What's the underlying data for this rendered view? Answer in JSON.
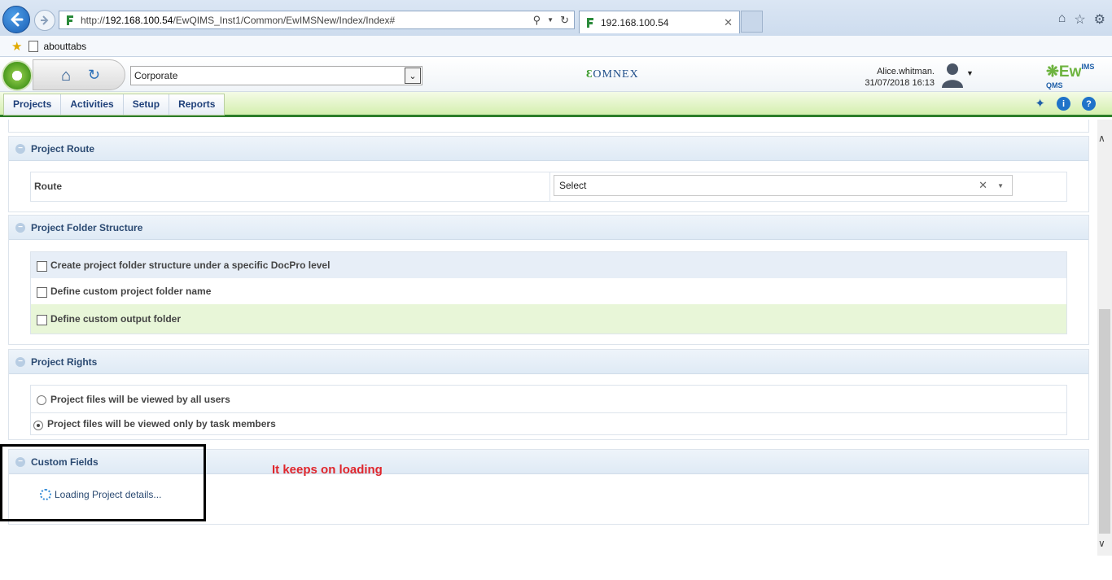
{
  "browser": {
    "url_prefix": "http://",
    "url_host": "192.168.100.54",
    "url_path": "/EwQIMS_Inst1/Common/EwIMSNew/Index/Index#",
    "tab_title": "192.168.100.54",
    "favorite": "abouttabs"
  },
  "header": {
    "site_select": "Corporate",
    "logo_text": "OMNEX",
    "user_name": "Alice.whitman.",
    "datetime": "31/07/2018 16:13",
    "brand": "Ew",
    "brand_sup": "IMS",
    "brand_sub": "QMS"
  },
  "menu": {
    "items": [
      "Projects",
      "Activities",
      "Setup",
      "Reports"
    ]
  },
  "sections": {
    "route": {
      "title": "Project Route",
      "label": "Route",
      "select_value": "Select"
    },
    "folder": {
      "title": "Project Folder Structure",
      "options": [
        "Create project folder structure under a specific DocPro level",
        "Define custom project folder name",
        "Define custom output folder"
      ]
    },
    "rights": {
      "title": "Project Rights",
      "options": [
        "Project files will be viewed by all users",
        "Project files will be viewed only by task members"
      ],
      "selected_index": 1
    },
    "custom": {
      "title": "Custom Fields",
      "loading": "Loading Project details..."
    }
  },
  "annotation": {
    "text": "It keeps on loading"
  },
  "colors": {
    "accent": "#2c7d2a",
    "menu_text": "#20417a",
    "annotation": "#e0262c"
  }
}
